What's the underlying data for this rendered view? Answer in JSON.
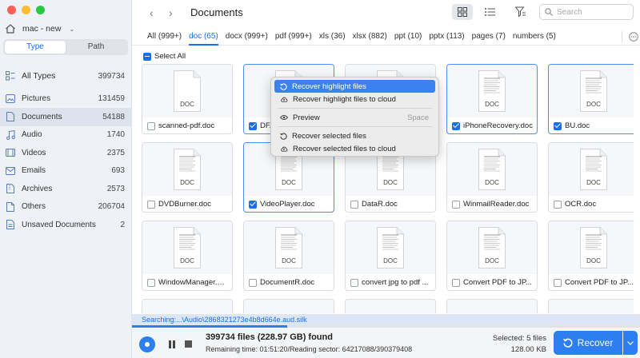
{
  "window": {
    "traffic_colors": [
      "#fe5f57",
      "#febc2e",
      "#28c840"
    ]
  },
  "sidebar": {
    "device_name": "mac - new",
    "segments": [
      {
        "label": "Type",
        "active": true
      },
      {
        "label": "Path",
        "active": false
      }
    ],
    "all_types": {
      "label": "All Types",
      "count": "399734",
      "icon": "grid-list-icon"
    },
    "items": [
      {
        "label": "Pictures",
        "count": "131459",
        "icon": "picture-icon"
      },
      {
        "label": "Documents",
        "count": "54188",
        "icon": "document-icon",
        "selected": true
      },
      {
        "label": "Audio",
        "count": "1740",
        "icon": "music-note-icon"
      },
      {
        "label": "Videos",
        "count": "2375",
        "icon": "video-icon"
      },
      {
        "label": "Emails",
        "count": "693",
        "icon": "mail-icon"
      },
      {
        "label": "Archives",
        "count": "2573",
        "icon": "archive-icon"
      },
      {
        "label": "Others",
        "count": "206704",
        "icon": "file-icon"
      },
      {
        "label": "Unsaved Documents",
        "count": "2",
        "icon": "unsaved-document-icon"
      }
    ]
  },
  "header": {
    "title": "Documents",
    "search_placeholder": "Search"
  },
  "type_tabs": [
    {
      "label": "All (999+)",
      "active": false
    },
    {
      "label": "doc (65)",
      "active": true
    },
    {
      "label": "docx (999+)",
      "active": false
    },
    {
      "label": "pdf (999+)",
      "active": false
    },
    {
      "label": "xls (36)",
      "active": false
    },
    {
      "label": "xlsx (882)",
      "active": false
    },
    {
      "label": "ppt (10)",
      "active": false
    },
    {
      "label": "pptx (113)",
      "active": false
    },
    {
      "label": "pages (7)",
      "active": false
    },
    {
      "label": "numbers (5)",
      "active": false
    }
  ],
  "select_all_label": "Select All",
  "thumb_label": "DOC",
  "files": [
    {
      "name": "scanned-pdf.doc",
      "checked": false,
      "blank": true
    },
    {
      "name": "DF.doc",
      "checked": true
    },
    {
      "name": "",
      "checked": false,
      "hidden_caption": true
    },
    {
      "name": "iPhoneRecovery.doc",
      "checked": true
    },
    {
      "name": "BU.doc",
      "checked": true
    },
    {
      "name": "DVDBurner.doc",
      "checked": false
    },
    {
      "name": "VideoPlayer.doc",
      "checked": true
    },
    {
      "name": "DataR.doc",
      "checked": false
    },
    {
      "name": "WinmailReader.doc",
      "checked": false
    },
    {
      "name": "OCR.doc",
      "checked": false
    },
    {
      "name": "WindowManager.doc",
      "checked": false
    },
    {
      "name": "DocumentR.doc",
      "checked": false
    },
    {
      "name": "convert jpg to pdf ...",
      "checked": false
    },
    {
      "name": "Convert  PDF to JP...",
      "checked": false
    },
    {
      "name": "Convert  PDF to JP...",
      "checked": false
    }
  ],
  "context_menu": {
    "group1": [
      {
        "label": "Recover highlight files",
        "icon": "recover-icon",
        "highlighted": true
      },
      {
        "label": "Recover highlight files to cloud",
        "icon": "cloud-recover-icon"
      }
    ],
    "group2": [
      {
        "label": "Preview",
        "icon": "eye-icon",
        "shortcut": "Space"
      }
    ],
    "group3": [
      {
        "label": "Recover selected files",
        "icon": "recover-icon"
      },
      {
        "label": "Recover selected files to cloud",
        "icon": "cloud-recover-icon"
      }
    ]
  },
  "status": {
    "searching": "Searching:...\\Audio\\2868321273e4b8d664e.aud.silk",
    "progress": 0.305,
    "found": "399734 files (228.97 GB) found",
    "remaining": "Remaining time: 01:51:20/Reading sector: 64217088/390379408",
    "selected": "Selected: 5 files",
    "selected_size": "128.00 KB",
    "recover_label": "Recover"
  },
  "colors": {
    "accent": "#1a6fe6",
    "button": "#2d7ff0",
    "menu_highlight": "#3b82f0"
  }
}
